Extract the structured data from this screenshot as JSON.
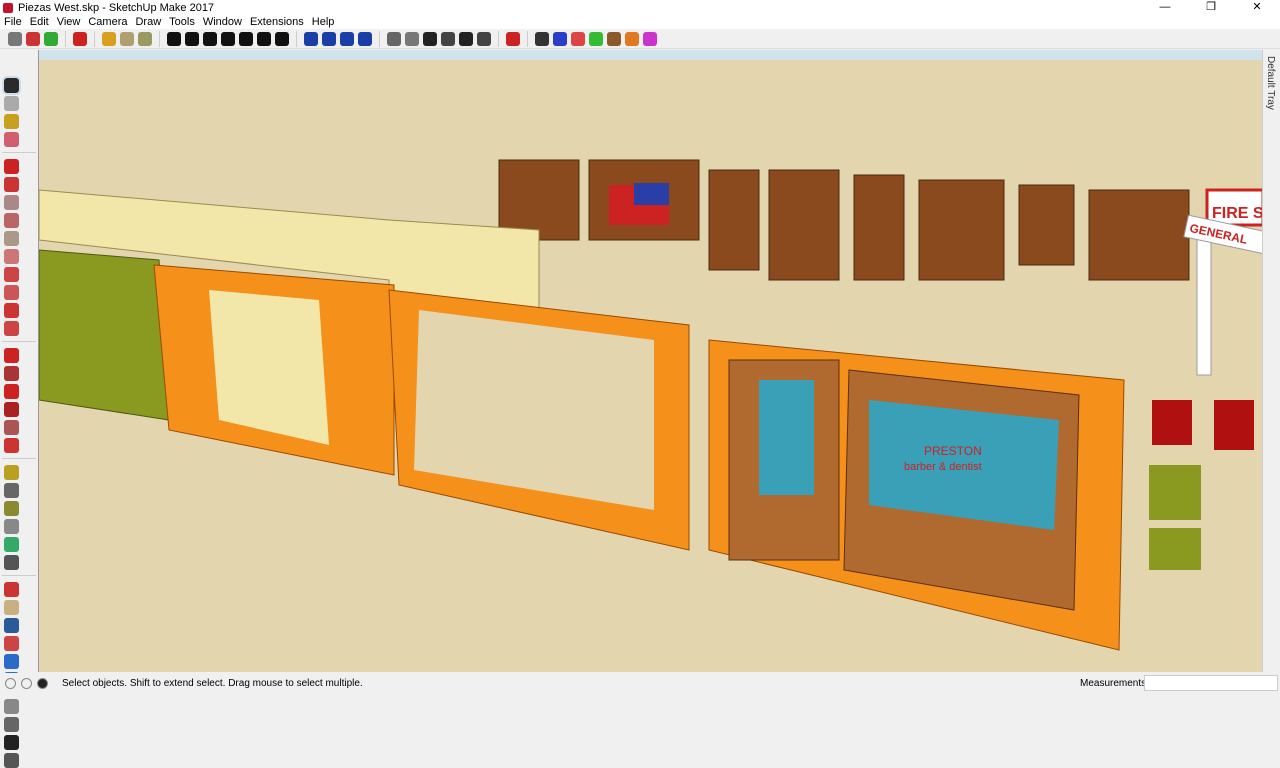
{
  "window": {
    "title": "Piezas West.skp - SketchUp Make 2017",
    "minimize": "—",
    "maximize": "❐",
    "close": "✕"
  },
  "menu": [
    "File",
    "Edit",
    "View",
    "Camera",
    "Draw",
    "Tools",
    "Window",
    "Extensions",
    "Help"
  ],
  "toolbar": {
    "icons": [
      "shield-icon",
      "lock-icon",
      "leaf-icon",
      "record-icon",
      "cube-icon",
      "cube-x-icon",
      "cube-y-icon",
      "union-icon",
      "subtract-icon",
      "intersect-icon",
      "trim-icon",
      "split-icon",
      "outer-shell-icon",
      "gear-icon",
      "arrow-down-bar-icon",
      "arrow-down-icon",
      "arrow-up-icon",
      "arrow-up-bar-icon",
      "house-1-icon",
      "house-2-icon",
      "house-3-icon",
      "house-4-icon",
      "house-5-icon",
      "house-6-icon",
      "red-push-icon",
      "black-push-icon",
      "blue-push-icon",
      "red-push-2-icon",
      "green-push-icon",
      "brown-push-icon",
      "orange-push-icon",
      "magenta-push-icon"
    ],
    "colors": [
      "#777",
      "#c33",
      "#3a3",
      "#c22",
      "#d9a020",
      "#b0a070",
      "#9a9a60",
      "#111",
      "#111",
      "#111",
      "#111",
      "#111",
      "#111",
      "#111",
      "#1a3ea8",
      "#1a3ea8",
      "#1a3ea8",
      "#1a3ea8",
      "#666",
      "#777",
      "#222",
      "#444",
      "#222",
      "#444",
      "#c22",
      "#333",
      "#2a3ec8",
      "#d44",
      "#3b3",
      "#8a5a2a",
      "#e07a20",
      "#c3c"
    ]
  },
  "left_tools": {
    "icons": [
      "select-icon",
      "component-icon",
      "paint-bucket-icon",
      "eraser-icon",
      "pencil-icon",
      "freehand-icon",
      "rectangle-icon",
      "rotated-rectangle-icon",
      "circle-icon",
      "polygon-icon",
      "arc-icon",
      "pie-icon",
      "two-point-arc-icon",
      "three-point-arc-icon",
      "move-icon",
      "push-pull-icon",
      "rotate-icon",
      "follow-me-icon",
      "scale-icon",
      "offset-icon",
      "tape-measure-icon",
      "dimension-icon",
      "protractor-icon",
      "text-icon",
      "axes-icon",
      "3d-text-icon",
      "orbit-icon",
      "pan-icon",
      "zoom-icon",
      "zoom-window-icon",
      "zoom-extents-icon",
      "previous-view-icon",
      "position-camera-icon",
      "look-around-icon",
      "walk-icon",
      "section-plane-icon"
    ],
    "colors": [
      "#2a2a2a",
      "#aaa",
      "#c8a020",
      "#d06070",
      "#c22",
      "#c33",
      "#a88",
      "#b66",
      "#a98",
      "#c77",
      "#c44",
      "#c55",
      "#c33",
      "#c44",
      "#c22",
      "#a33",
      "#c22",
      "#a22",
      "#a55",
      "#c33",
      "#b9a020",
      "#666",
      "#8a8a30",
      "#888",
      "#3a6",
      "#555",
      "#c33",
      "#c9b080",
      "#2a5a9a",
      "#c44",
      "#2a6ac8",
      "#2a70b8",
      "#888",
      "#666",
      "#222",
      "#555"
    ]
  },
  "tray": {
    "label": "Default Tray"
  },
  "status": {
    "text": "Select objects. Shift to extend select. Drag mouse to select multiple.",
    "measurements_label": "Measurements",
    "measurements_value": ""
  },
  "scene": {
    "sign_text": "FIRE S",
    "sign_text_2": "GENERAL",
    "shop_text_1": "PRESTON",
    "shop_text_2": "barber & dentist"
  }
}
